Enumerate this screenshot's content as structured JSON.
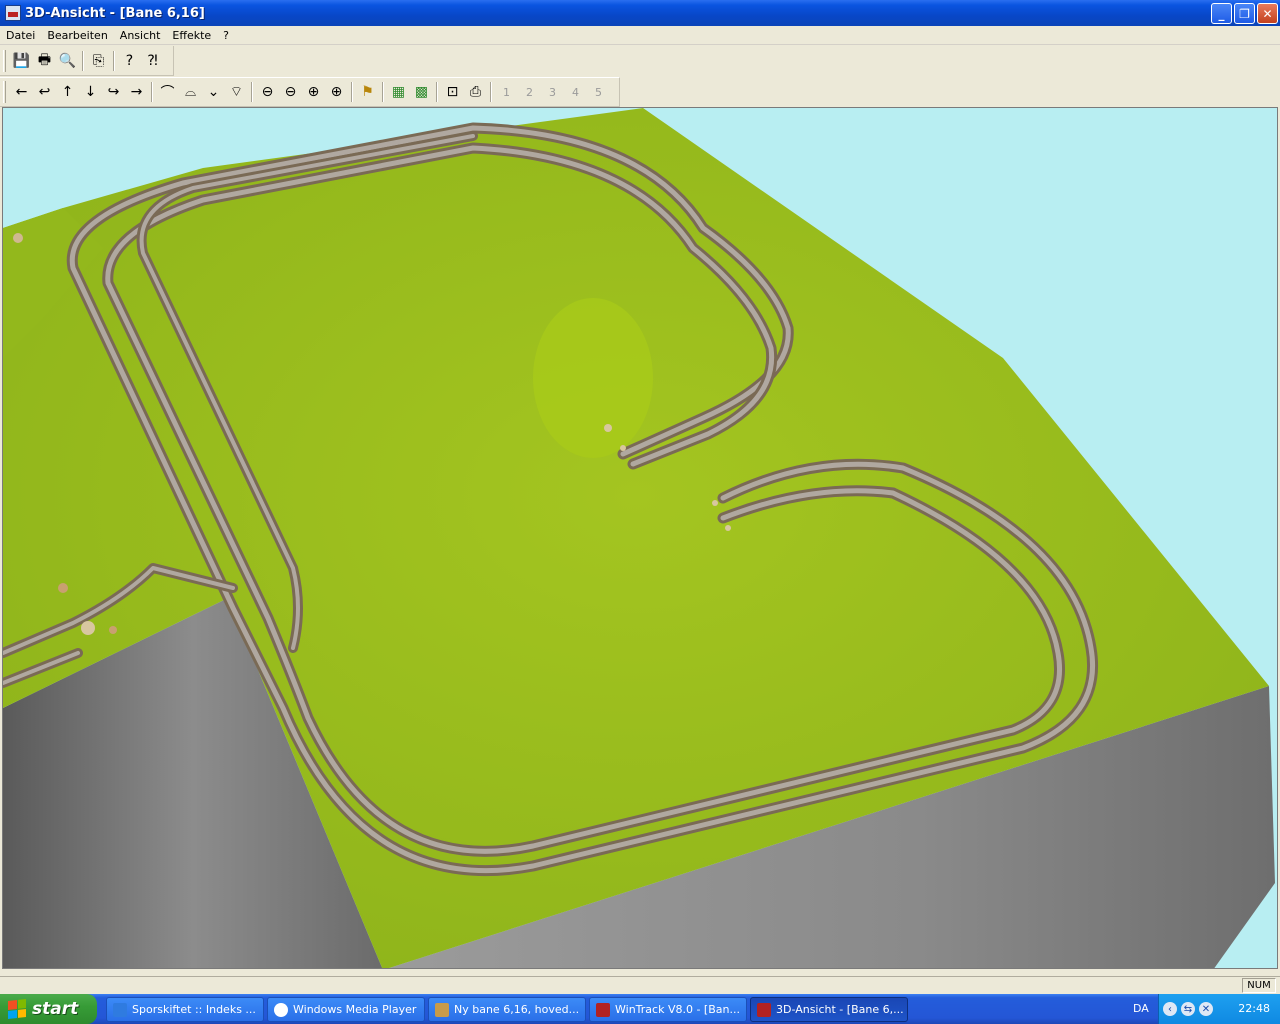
{
  "window": {
    "title": "3D-Ansicht - [Bane 6,16]",
    "buttons": {
      "minimize": "_",
      "maximize": "❐",
      "close": "✕"
    }
  },
  "menu": [
    "Datei",
    "Bearbeiten",
    "Ansicht",
    "Effekte",
    "?"
  ],
  "toolbar1": {
    "items": [
      {
        "name": "save-icon",
        "glyph": "💾"
      },
      {
        "name": "print-icon",
        "glyph": "🖶"
      },
      {
        "name": "print-preview-icon",
        "glyph": "🔍"
      },
      {
        "name": "copy-icon",
        "glyph": "⎘"
      },
      {
        "name": "help-icon",
        "glyph": "?"
      },
      {
        "name": "context-help-icon",
        "glyph": "⁈"
      }
    ]
  },
  "toolbar2": {
    "nav": [
      "←",
      "↩",
      "↑",
      "↓",
      "↪",
      "→"
    ],
    "camera": [
      "⌒",
      "⌓",
      "⌄",
      "⌔"
    ],
    "zoom": [
      "⊖",
      "⊖",
      "⊕",
      "⊕"
    ],
    "view": [
      "⚑",
      "▦",
      "▩",
      "⊡",
      "⎙"
    ],
    "presets": [
      "1",
      "2",
      "3",
      "4",
      "5"
    ]
  },
  "status": {
    "num": "NUM"
  },
  "taskbar": {
    "start": "start",
    "tasks": [
      {
        "label": "Sporskiftet :: Indeks ...",
        "color": "#2f7be0"
      },
      {
        "label": "Windows Media Player",
        "color": "#ffffff"
      },
      {
        "label": "Ny bane 6,16, hoved...",
        "color": "#c89b4a"
      },
      {
        "label": "WinTrack  V8.0 - [Ban...",
        "color": "#b22222"
      },
      {
        "label": "3D-Ansicht - [Bane 6,...",
        "color": "#b22222"
      }
    ],
    "lang": "DA",
    "clock": "22:48"
  }
}
